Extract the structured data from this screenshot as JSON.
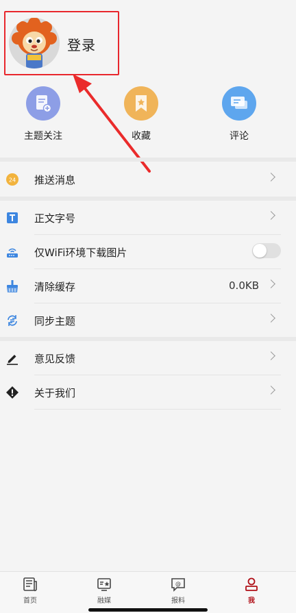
{
  "profile": {
    "login_label": "登录",
    "avatar_icon": "lion-mascot-avatar"
  },
  "quick_actions": [
    {
      "label": "主题关注",
      "icon": "topic-follow-icon",
      "color": "#8d9ee6"
    },
    {
      "label": "收藏",
      "icon": "favorites-icon",
      "color": "#f0b459"
    },
    {
      "label": "评论",
      "icon": "comment-icon",
      "color": "#5ea6ee"
    }
  ],
  "settings": {
    "push": {
      "label": "推送消息",
      "icon": "push-24-icon"
    },
    "font_size": {
      "label": "正文字号",
      "icon": "text-size-icon"
    },
    "wifi_images": {
      "label": "仅WiFi环境下载图片",
      "icon": "router-icon",
      "enabled": false
    },
    "clear_cache": {
      "label": "清除缓存",
      "icon": "broom-icon",
      "value": "0.0KB"
    },
    "sync_topics": {
      "label": "同步主题",
      "icon": "sync-icon"
    },
    "feedback": {
      "label": "意见反馈",
      "icon": "pen-icon"
    },
    "about": {
      "label": "关于我们",
      "icon": "info-diamond-icon"
    }
  },
  "tabs": [
    {
      "label": "首页",
      "icon": "newspaper-icon",
      "active": false
    },
    {
      "label": "融媒",
      "icon": "media-icon",
      "active": false
    },
    {
      "label": "报料",
      "icon": "report-chat-icon",
      "active": false
    },
    {
      "label": "我",
      "icon": "person-icon",
      "active": true
    }
  ],
  "colors": {
    "accent": "#b00f17",
    "highlight_box": "#e8262c"
  }
}
